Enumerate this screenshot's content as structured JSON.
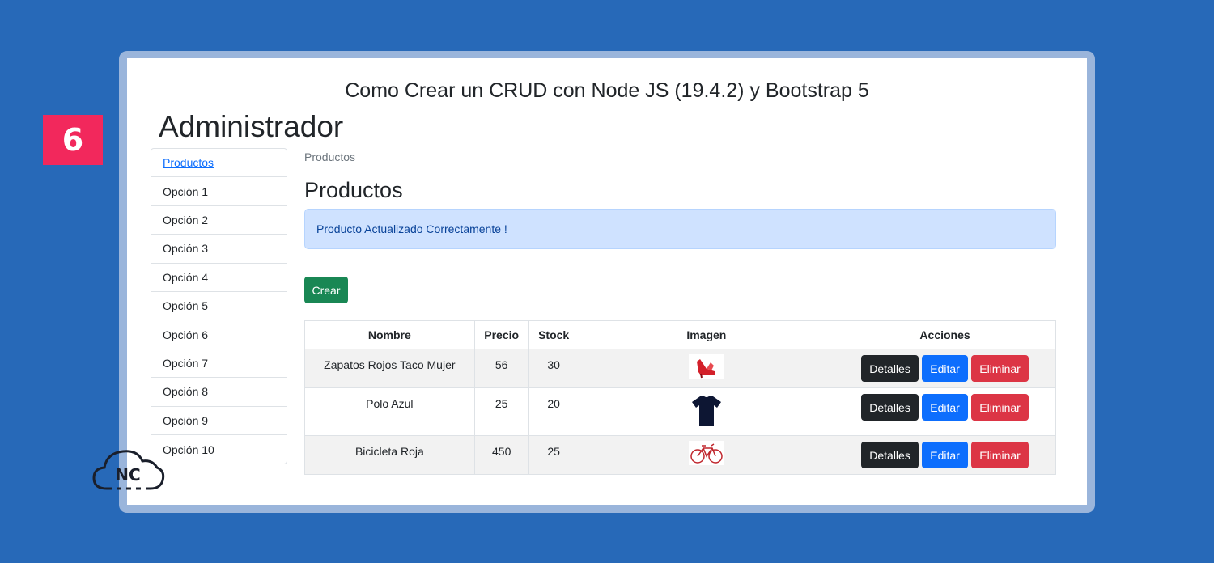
{
  "step_badge": "6",
  "top_title": "Como Crear un CRUD con Node JS (19.4.2) y Bootstrap 5",
  "admin_title": "Administrador",
  "sidebar": {
    "items": [
      {
        "label": "Productos",
        "active": true
      },
      {
        "label": "Opción 1"
      },
      {
        "label": "Opción 2"
      },
      {
        "label": "Opción 3"
      },
      {
        "label": "Opción 4"
      },
      {
        "label": "Opción 5"
      },
      {
        "label": "Opción 6"
      },
      {
        "label": "Opción 7"
      },
      {
        "label": "Opción 8"
      },
      {
        "label": "Opción 9"
      },
      {
        "label": "Opción 10"
      }
    ]
  },
  "breadcrumb": "Productos",
  "section_title": "Productos",
  "alert": "Producto Actualizado Correctamente !",
  "create_label": "Crear",
  "table": {
    "headers": [
      "Nombre",
      "Precio",
      "Stock",
      "Imagen",
      "Acciones"
    ],
    "rows": [
      {
        "nombre": "Zapatos Rojos Taco Mujer",
        "precio": "56",
        "stock": "30",
        "image_icon": "red-shoe-image"
      },
      {
        "nombre": "Polo Azul",
        "precio": "25",
        "stock": "20",
        "image_icon": "blue-tshirt-image"
      },
      {
        "nombre": "Bicicleta Roja",
        "precio": "450",
        "stock": "25",
        "image_icon": "red-bicycle-image"
      }
    ],
    "actions": {
      "details": "Detalles",
      "edit": "Editar",
      "delete": "Eliminar"
    }
  },
  "logo_text": "NC",
  "colors": {
    "background": "#2769b8",
    "badge": "#f2285c",
    "success": "#198754",
    "primary": "#0d6efd",
    "danger": "#dc3545",
    "dark": "#212529"
  }
}
